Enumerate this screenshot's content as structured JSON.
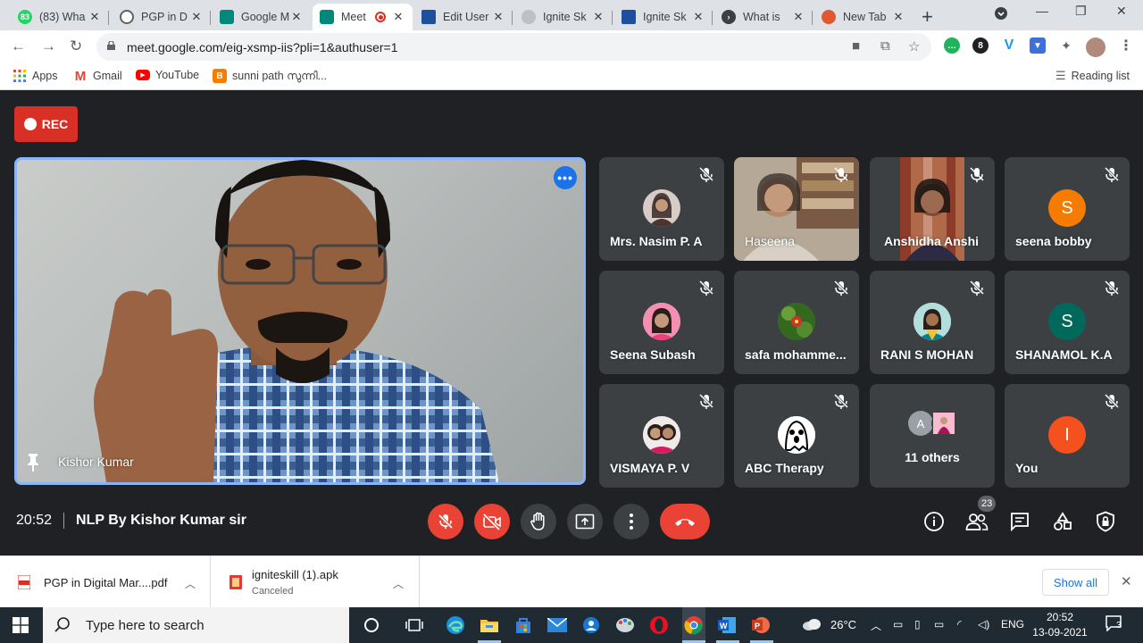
{
  "browser": {
    "tabs": [
      {
        "title": "(83) Wha",
        "favicon": "whatsapp-icon",
        "badge": "83",
        "color": "#25d366"
      },
      {
        "title": "PGP in D",
        "favicon": "globe-icon",
        "color": "#5f6368"
      },
      {
        "title": "Google M",
        "favicon": "google-meet-icon",
        "color": "#00897b"
      },
      {
        "title": "Meet",
        "favicon": "google-meet-icon",
        "color": "#00897b",
        "active": true,
        "recording": true
      },
      {
        "title": "Edit User",
        "favicon": "site-icon",
        "color": "#1e4f9c"
      },
      {
        "title": "Ignite Sk",
        "favicon": "graduation-cap-icon",
        "color": "#9aa0a6"
      },
      {
        "title": "Ignite Sk",
        "favicon": "site-icon",
        "color": "#1e4f9c"
      },
      {
        "title": "What is",
        "favicon": "chevron-circle-icon",
        "color": "#3c4043"
      },
      {
        "title": "New Tab",
        "favicon": "duckduckgo-icon",
        "color": "#de5833"
      }
    ],
    "url": "meet.google.com/eig-xsmp-iis?pli=1&authuser=1",
    "bookmarks": [
      {
        "label": "Apps",
        "icon": "apps-grid-icon"
      },
      {
        "label": "Gmail",
        "icon": "gmail-icon"
      },
      {
        "label": "YouTube",
        "icon": "youtube-icon"
      },
      {
        "label": "sunni path സുന്നി...",
        "icon": "blogger-icon"
      }
    ],
    "reading_list": "Reading list"
  },
  "meet": {
    "rec_label": "REC",
    "main_speaker": "Kishor Kumar",
    "participants": [
      {
        "name": "Mrs. Nasim P. A",
        "type": "avatar-photo",
        "color": "#6d4c41"
      },
      {
        "name": "Haseena",
        "type": "video"
      },
      {
        "name": "Anshidha Anshi",
        "type": "video"
      },
      {
        "name": "seena bobby",
        "type": "letter",
        "letter": "S",
        "color": "#f57c00"
      },
      {
        "name": "Seena Subash",
        "type": "avatar-photo",
        "color": "#e91e63"
      },
      {
        "name": "safa mohamme...",
        "type": "avatar-photo",
        "color": "#2e7d32"
      },
      {
        "name": "RANI S MOHAN",
        "type": "avatar-photo",
        "color": "#00838f"
      },
      {
        "name": "SHANAMOL K.A",
        "type": "letter",
        "letter": "S",
        "color": "#00695c"
      },
      {
        "name": "VISMAYA P. V",
        "type": "avatar-photo",
        "color": "#8d6e63"
      },
      {
        "name": "ABC Therapy",
        "type": "avatar-photo",
        "color": "#fafafa"
      },
      {
        "name": "You",
        "type": "letter",
        "letter": "I",
        "color": "#f4511e"
      }
    ],
    "others": {
      "label": "11 others",
      "letter": "A"
    },
    "time": "20:52",
    "meeting_title": "NLP By Kishor Kumar sir",
    "participant_count": "23"
  },
  "downloads": [
    {
      "name": "PGP in Digital Mar....pdf",
      "status": ""
    },
    {
      "name": "igniteskill (1).apk",
      "status": "Canceled"
    }
  ],
  "show_all": "Show all",
  "taskbar": {
    "search_placeholder": "Type here to search",
    "weather": "26°C",
    "language": "ENG",
    "time": "20:52",
    "date": "13-09-2021",
    "notification_count": "3"
  }
}
